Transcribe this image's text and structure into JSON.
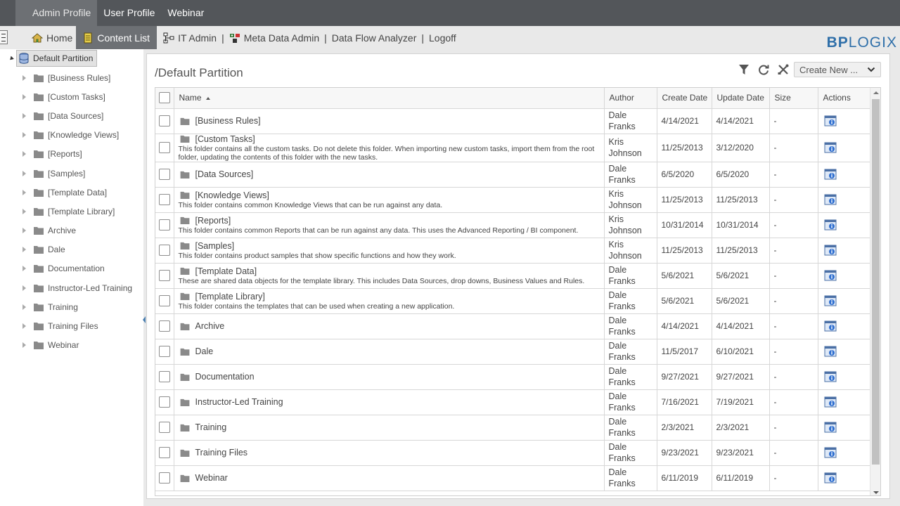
{
  "top_tabs": [
    "Admin Profile",
    "User Profile",
    "Webinar"
  ],
  "nav": {
    "home": "Home",
    "content_list": "Content List",
    "it_admin": "IT Admin",
    "meta_data_admin": "Meta Data Admin",
    "data_flow_analyzer": "Data Flow Analyzer",
    "logoff": "Logoff",
    "separator": "|"
  },
  "logo": {
    "part1": "BP",
    "part2": "LOGIX"
  },
  "tree": {
    "root": "Default Partition",
    "items": [
      "[Business Rules]",
      "[Custom Tasks]",
      "[Data Sources]",
      "[Knowledge Views]",
      "[Reports]",
      "[Samples]",
      "[Template Data]",
      "[Template Library]",
      "Archive",
      "Dale",
      "Documentation",
      "Instructor-Led Training",
      "Training",
      "Training Files",
      "Webinar"
    ]
  },
  "content": {
    "title": "/Default Partition",
    "create_new": "Create New ...",
    "columns": {
      "name": "Name",
      "author": "Author",
      "create_date": "Create Date",
      "update_date": "Update Date",
      "size": "Size",
      "actions": "Actions"
    },
    "rows": [
      {
        "name": "[Business Rules]",
        "desc": "",
        "author_first": "Dale",
        "author_last": "Franks",
        "created": "4/14/2021",
        "updated": "4/14/2021",
        "size": "-"
      },
      {
        "name": "[Custom Tasks]",
        "desc": "This folder contains all the custom tasks. Do not delete this folder. When importing new custom tasks, import them from the root folder, updating the contents of this folder with the new tasks.",
        "author_first": "Kris",
        "author_last": "Johnson",
        "created": "11/25/2013",
        "updated": "3/12/2020",
        "size": "-"
      },
      {
        "name": "[Data Sources]",
        "desc": "",
        "author_first": "Dale",
        "author_last": "Franks",
        "created": "6/5/2020",
        "updated": "6/5/2020",
        "size": "-"
      },
      {
        "name": "[Knowledge Views]",
        "desc": "This folder contains common Knowledge Views that can be run against any data.",
        "author_first": "Kris",
        "author_last": "Johnson",
        "created": "11/25/2013",
        "updated": "11/25/2013",
        "size": "-"
      },
      {
        "name": "[Reports]",
        "desc": "This folder contains common Reports that can be run against any data. This uses the Advanced Reporting / BI component.",
        "author_first": "Kris",
        "author_last": "Johnson",
        "created": "10/31/2014",
        "updated": "10/31/2014",
        "size": "-"
      },
      {
        "name": "[Samples]",
        "desc": "This folder contains product samples that show specific functions and how they work.",
        "author_first": "Kris",
        "author_last": "Johnson",
        "created": "11/25/2013",
        "updated": "11/25/2013",
        "size": "-"
      },
      {
        "name": "[Template Data]",
        "desc": "These are shared data objects for the template library. This includes Data Sources, drop downs, Business Values and Rules.",
        "author_first": "Dale",
        "author_last": "Franks",
        "created": "5/6/2021",
        "updated": "5/6/2021",
        "size": "-"
      },
      {
        "name": "[Template Library]",
        "desc": "This folder contains the templates that can be used when creating a new application.",
        "author_first": "Dale",
        "author_last": "Franks",
        "created": "5/6/2021",
        "updated": "5/6/2021",
        "size": "-"
      },
      {
        "name": "Archive",
        "desc": "",
        "author_first": "Dale",
        "author_last": "Franks",
        "created": "4/14/2021",
        "updated": "4/14/2021",
        "size": "-"
      },
      {
        "name": "Dale",
        "desc": "",
        "author_first": "Dale",
        "author_last": "Franks",
        "created": "11/5/2017",
        "updated": "6/10/2021",
        "size": "-"
      },
      {
        "name": "Documentation",
        "desc": "",
        "author_first": "Dale",
        "author_last": "Franks",
        "created": "9/27/2021",
        "updated": "9/27/2021",
        "size": "-"
      },
      {
        "name": "Instructor-Led Training",
        "desc": "",
        "author_first": "Dale",
        "author_last": "Franks",
        "created": "7/16/2021",
        "updated": "7/19/2021",
        "size": "-"
      },
      {
        "name": "Training",
        "desc": "",
        "author_first": "Dale",
        "author_last": "Franks",
        "created": "2/3/2021",
        "updated": "2/3/2021",
        "size": "-"
      },
      {
        "name": "Training Files",
        "desc": "",
        "author_first": "Dale",
        "author_last": "Franks",
        "created": "9/23/2021",
        "updated": "9/23/2021",
        "size": "-"
      },
      {
        "name": "Webinar",
        "desc": "",
        "author_first": "Dale",
        "author_last": "Franks",
        "created": "6/11/2019",
        "updated": "6/11/2019",
        "size": "-"
      }
    ]
  },
  "icons": {
    "folder": "folder-icon",
    "actions": "properties-icon",
    "filter": "filter-icon",
    "refresh": "refresh-icon",
    "tools": "tools-icon"
  },
  "colors": {
    "topbar": "#53565a",
    "active_tab": "#6d7074",
    "logo": "#2f6fa9",
    "folder": "#8a8a8a"
  }
}
